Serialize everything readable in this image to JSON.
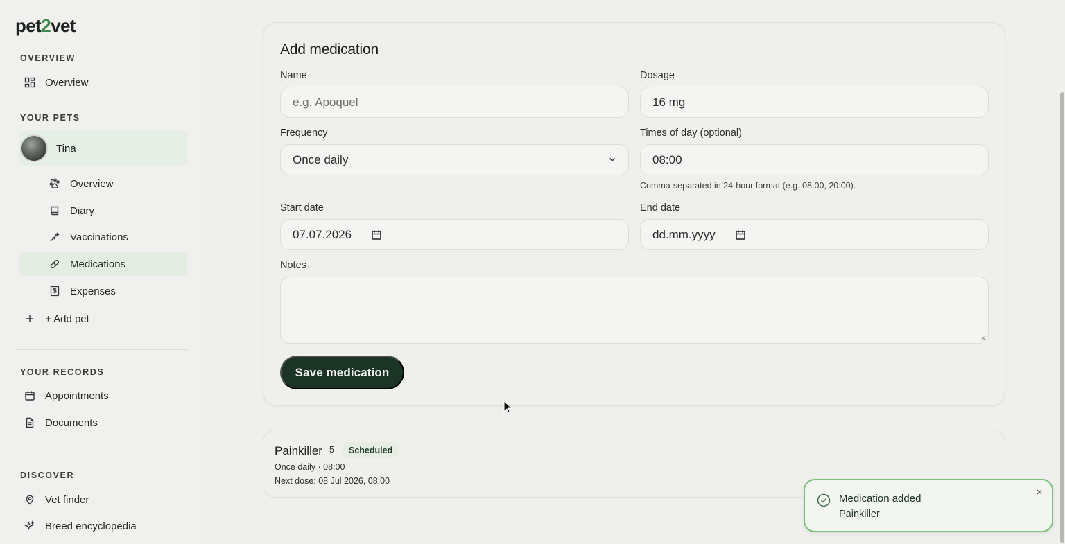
{
  "app": {
    "logo_prefix": "pet",
    "logo_two": "2",
    "logo_suffix": "vet"
  },
  "sidebar": {
    "sections": {
      "overview": "OVERVIEW",
      "pets": "YOUR PETS",
      "records": "YOUR RECORDS",
      "discover": "DISCOVER"
    },
    "overview_item": "Overview",
    "pet": {
      "name": "Tina"
    },
    "pet_items": [
      "Overview",
      "Diary",
      "Vaccinations",
      "Medications",
      "Expenses"
    ],
    "active_pet_item": "Medications",
    "add_pet": "+ Add pet",
    "records_items": [
      "Appointments",
      "Documents"
    ],
    "discover_items": [
      "Vet finder",
      "Breed encyclopedia"
    ]
  },
  "form": {
    "title": "Add medication",
    "name": {
      "label": "Name",
      "placeholder": "e.g. Apoquel",
      "value": ""
    },
    "dosage": {
      "label": "Dosage",
      "value": "16 mg"
    },
    "frequency": {
      "label": "Frequency",
      "value": "Once daily"
    },
    "times": {
      "label": "Times of day (optional)",
      "value": "08:00",
      "hint": "Comma-separated in 24-hour format (e.g. 08:00, 20:00)."
    },
    "start_date": {
      "label": "Start date",
      "value": "07.07.2026"
    },
    "end_date": {
      "label": "End date",
      "value": "dd.mm.yyyy"
    },
    "notes": {
      "label": "Notes",
      "value": ""
    },
    "save_label": "Save medication"
  },
  "medications": [
    {
      "name": "Painkiller",
      "count": "5",
      "status": "Scheduled",
      "schedule": "Once daily · 08:00",
      "next_dose": "Next dose: 08 Jul 2026, 08:00"
    }
  ],
  "toast": {
    "title": "Medication added",
    "message": "Painkiller"
  },
  "colors": {
    "accent": "#1c3426",
    "active_bg": "#e3ede2",
    "toast_border": "#7cc07b",
    "logo_two": "#3c8a4a"
  }
}
